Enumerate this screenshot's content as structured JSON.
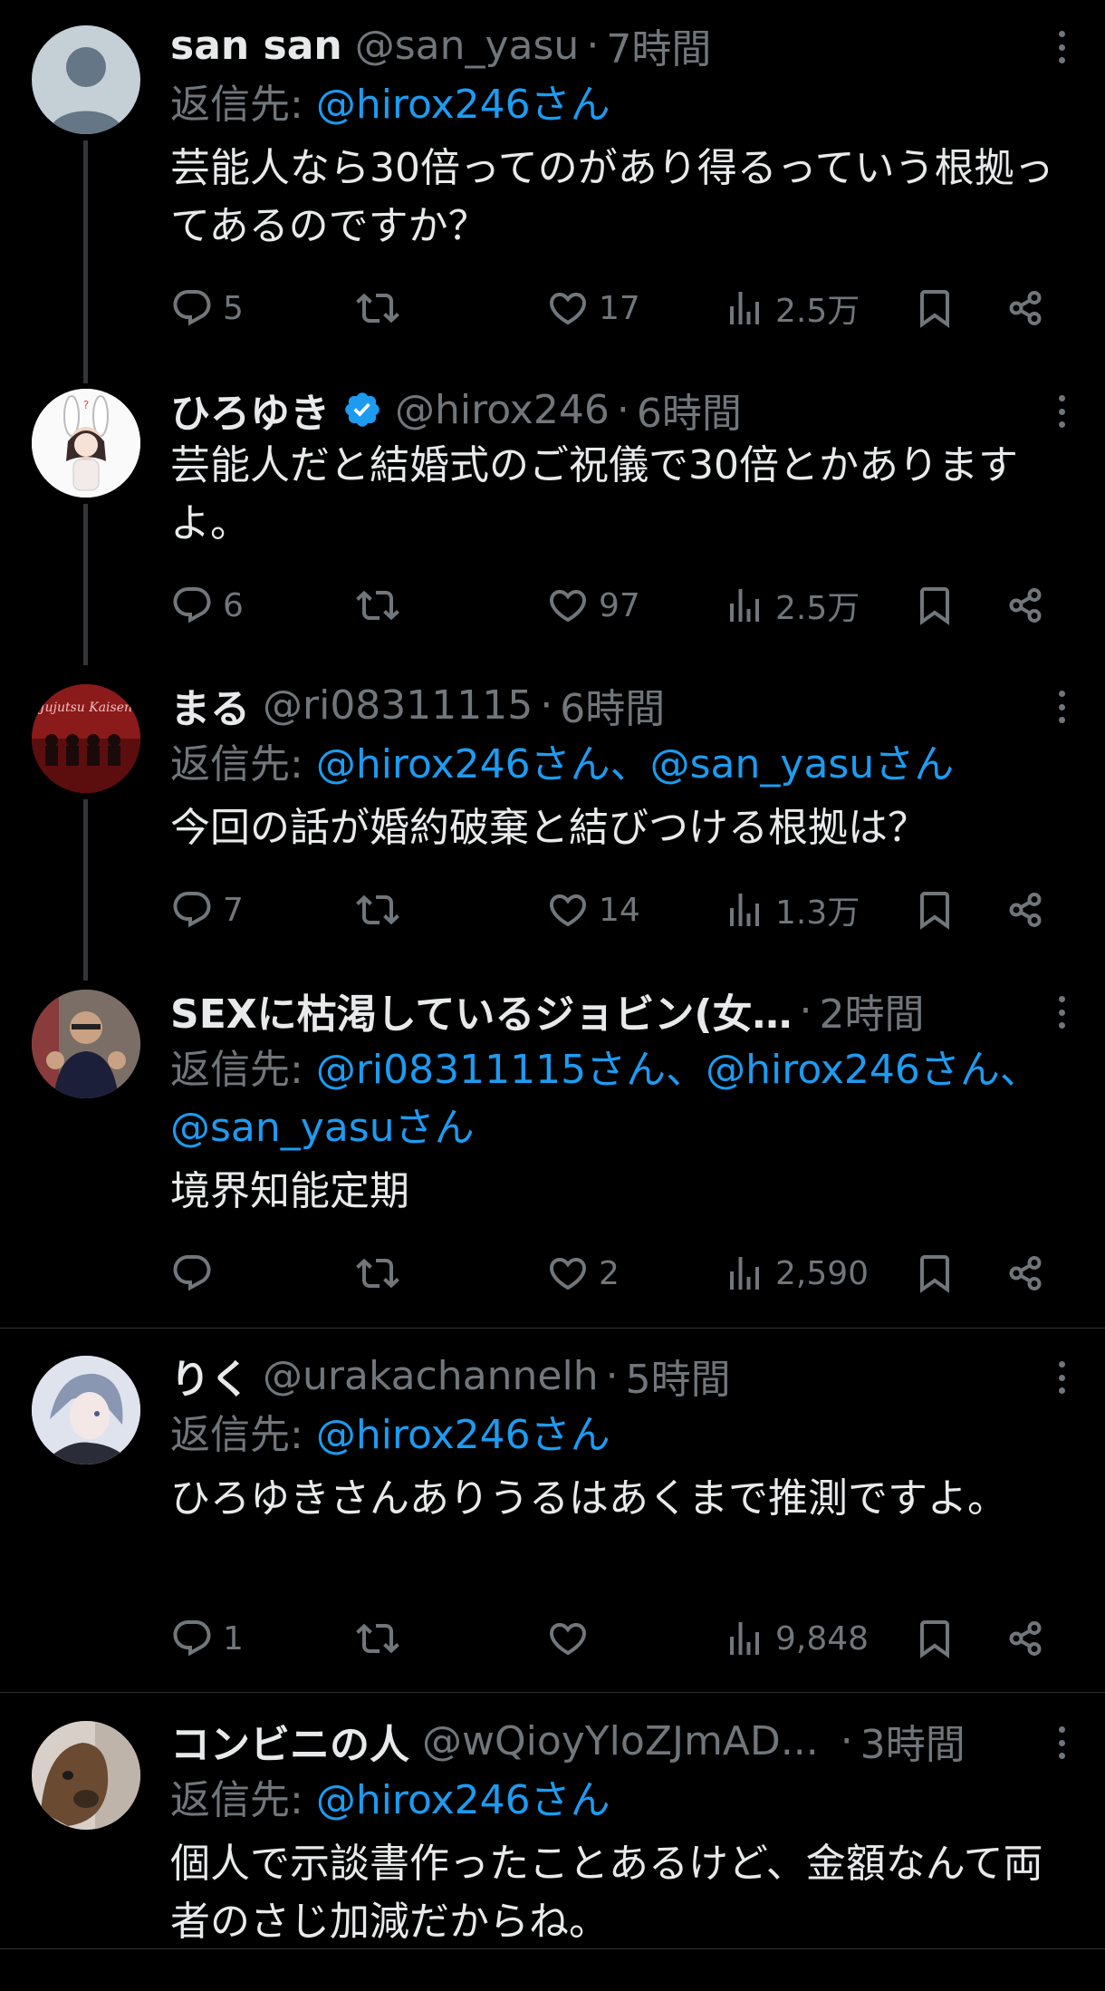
{
  "reply_prefix": "返信先: ",
  "posts": [
    {
      "name": "san san",
      "handle": "@san_yasu",
      "dot": "·",
      "time": "7時間",
      "reply_mentions": "@hirox246さん",
      "text": "芸能人なら30倍ってのがあり得るっていう根拠ってあるのですか？",
      "replies": "5",
      "retweets": "",
      "likes": "17",
      "views": "2.5万",
      "avatar_icon": "default-avatar-icon"
    },
    {
      "name": "ひろゆき",
      "handle": "@hirox246",
      "dot": "·",
      "time": "6時間",
      "verified": true,
      "text": "芸能人だと結婚式のご祝儀で30倍とかありますよ。",
      "replies": "6",
      "retweets": "",
      "likes": "97",
      "views": "2.5万",
      "avatar_icon": "bunny-girl-avatar"
    },
    {
      "name": "まる",
      "handle": "@ri08311115",
      "dot": "·",
      "time": "6時間",
      "reply_mentions": "@hirox246さん、@san_yasuさん",
      "text": "今回の話が婚約破棄と結びつける根拠は？",
      "replies": "7",
      "retweets": "",
      "likes": "14",
      "views": "1.3万",
      "avatar_icon": "jujutsu-kaisen-avatar",
      "avatar_text": "Jujutsu Kaisen"
    },
    {
      "name": "SEXに枯渇しているジョビン(女…",
      "handle": "",
      "dot": "·",
      "time": "2時間",
      "reply_mentions_1": "@ri08311115さん、@hirox246さん、",
      "reply_mentions_2": "@san_yasuさん",
      "text": "境界知能定期",
      "replies": "",
      "retweets": "",
      "likes": "2",
      "views": "2,590",
      "avatar_icon": "man-photo-avatar"
    },
    {
      "name": "りく",
      "handle": "@urakachannelh",
      "dot": "·",
      "time": "5時間",
      "reply_mentions": "@hirox246さん",
      "text": "ひろゆきさんありうるはあくまで推測ですよ。",
      "replies": "1",
      "retweets": "",
      "likes": "",
      "views": "9,848",
      "avatar_icon": "anime-boy-avatar"
    },
    {
      "name": "コンビニの人",
      "handle": "@wQioyYloZJmAD...",
      "dot": "·",
      "time": "3時間",
      "reply_mentions": "@hirox246さん",
      "text": "個人で示談書作ったことあるけど、金額なんて両者のさじ加減だからね。",
      "avatar_icon": "dog-photo-avatar"
    }
  ],
  "colors": {
    "background": "#000000",
    "text": "#e7e9ea",
    "muted": "#71767b",
    "link": "#1d9bf0",
    "line": "#333639"
  },
  "icons": {
    "reply": "reply-icon",
    "retweet": "retweet-icon",
    "like": "heart-icon",
    "views": "views-icon",
    "bookmark": "bookmark-icon",
    "share": "share-icon",
    "more": "more-icon",
    "verified": "verified-badge-icon"
  }
}
